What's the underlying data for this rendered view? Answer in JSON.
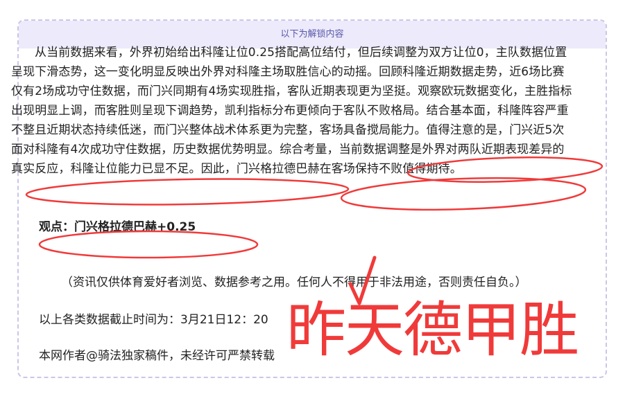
{
  "header": {
    "title": "以下为解锁内容"
  },
  "article": {
    "paragraph": "从当前数据来看，外界初始给出科隆让位0.25搭配高位结付，但后续调整为双方让位0，主队数据位置呈现下滑态势，这一变化明显反映出外界对科隆主场取胜信心的动摇。回顾科隆近期数据走势，近6场比赛仅有2场成功守住数据，而门兴同期有4场实现胜指，客队近期表现更为坚挺。观察欧玩数据变化，主胜指标出现明显上调，而客胜则呈现下调趋势，凯利指标分布更倾向于客队不败格局。结合基本面，科隆阵容严重不整且近期状态持续低迷，而门兴整体战术体系更为完整，客场具备搅局能力。值得注意的是，门兴近5次面对科隆有4次成功守住数据，历史数据优势明显。综合考量，当前数据调整是外界对两队近期表现差异的真实反应，科隆让位能力已显不足。因此，门兴格拉德巴赫在客场保持不败值得期待。",
    "viewpoint": "观点：门兴格拉德巴赫+0.25",
    "disclaimer": "（资讯仅供体育爱好者浏览、数据参考之用。任何人不得用于非法用途，否则责任自负。）",
    "cutoff": "以上各类数据截止时间为：3月21日12：20",
    "author": "本网作者@骑法独家稿件，未经许可严禁转载"
  },
  "annotation": {
    "handwritten_text": "昨天德甲胜",
    "checkmark": "√",
    "color": "#f03a3a"
  },
  "colors": {
    "header_bg": "#eceafb",
    "header_text": "#5a57a8",
    "border": "#c9c6e8"
  }
}
